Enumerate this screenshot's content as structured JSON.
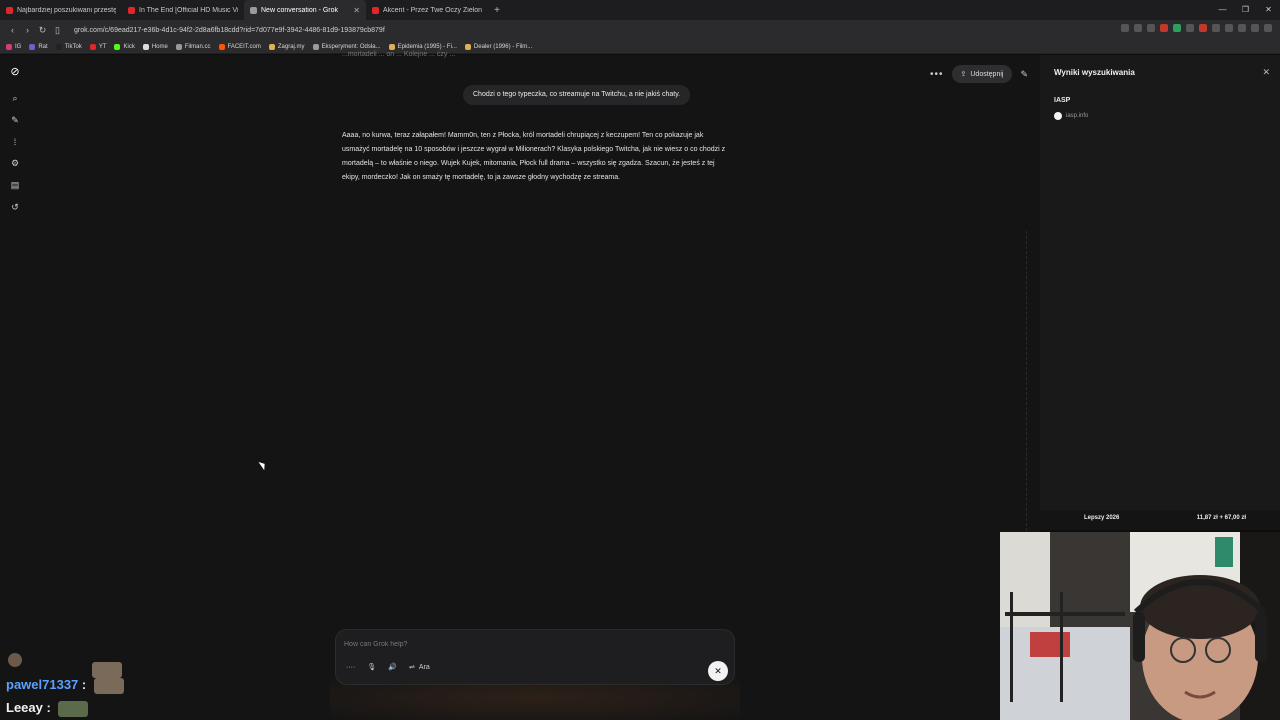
{
  "browser": {
    "tabs": [
      {
        "title": "Najbardziej poszukiwani przestępcy",
        "favicon_color": "#e0262b"
      },
      {
        "title": "In The End [Official HD Music Video]",
        "favicon_color": "#e0262b"
      },
      {
        "title": "New conversation - Grok",
        "favicon_color": "#9a9a9a",
        "active": true
      },
      {
        "title": "Akcent - Przez Twe Oczy Zielone (Of...",
        "favicon_color": "#e0262b"
      }
    ],
    "url": "grok.com/c/69ead217-e36b-4d1c-94f2-2d8a6fb18cdd?rid=7d077e9f-3942-4486-81d9-193879cb879f",
    "bookmarks": [
      "IG",
      "Rat",
      "TikTok",
      "YT",
      "Kick",
      "Home",
      "Filman.cc",
      "FACEIT.com",
      "Zagraj.my",
      "Eksperyment: Odsła...",
      "Epidemia (1995) - Fi...",
      "Dealer (1996) - Film..."
    ]
  },
  "grok": {
    "share_label": "Udostępnij",
    "truncated_text": "...mortadeli ... on ... Kolejne ... czy ... ",
    "user_message": "Chodzi o tego typeczka, co streamuje na Twitchu, a nie jakiś chaty.",
    "assistant_message": "Aaaa, no kurwa, teraz załapałem! Mamm0n, ten z Płocka, król mortadeli chrupiącej z keczupem! Ten co pokazuje jak usmażyć mortadelę na 10 sposobów i jeszcze wygrał w Milionerach? Klasyka polskiego Twitcha, jak nie wiesz o co chodzi z mortadelą – to właśnie o niego. Wujek Kujek, mitomania, Płock full drama – wszystko się zgadza. Szacun, że jesteś z tej ekipy, mordeczko! Jak on smaży tę mortadelę, to ja zawsze głodny wychodzę ze streama.",
    "composer_placeholder": "How can Grok help?",
    "voice_label": "Ara"
  },
  "search_panel": {
    "title": "Wyniki wyszukiwania",
    "source_title": "IASP",
    "source_domain": "iasp.info"
  },
  "ticker": {
    "left": "Lepszy 2026",
    "right": "11,87 zł + 67,00 zł"
  },
  "chat": [
    {
      "user": "pawel71337",
      "sep": ":"
    },
    {
      "user": "Leeay",
      "sep": ":"
    }
  ]
}
